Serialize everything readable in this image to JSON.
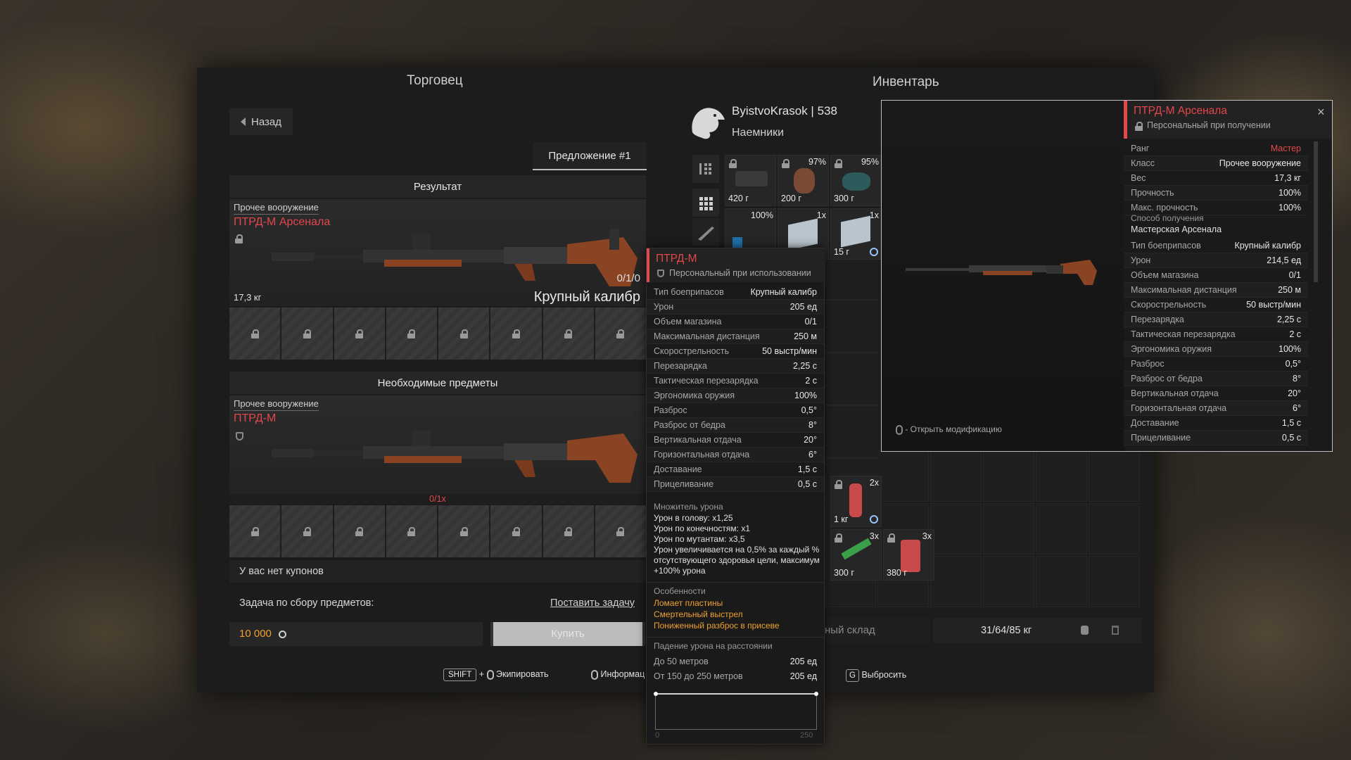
{
  "trader": {
    "title": "Торговец",
    "back": "Назад",
    "offer_tab": "Предложение #1",
    "result_title": "Результат",
    "result": {
      "category": "Прочее вооружение",
      "name": "ПТРД-М Арсенала",
      "weight": "17,3 кг",
      "ammo": "0/1/0",
      "caliber": "Крупный калибр"
    },
    "required_title": "Необходимые предметы",
    "required": {
      "category": "Прочее вооружение",
      "name": "ПТРД-М",
      "count": "0/1x"
    },
    "coupons": "У вас нет купонов",
    "task_label": "Задача по сбору предметов:",
    "task_link": "Поставить задачу",
    "price": "10 000",
    "buy": "Купить"
  },
  "inventory": {
    "title": "Инвентарь",
    "player": "ByistvoKrasok | 538",
    "faction": "Наемники",
    "storage": "ный склад",
    "weight": "31/64/85 кг",
    "items": [
      {
        "weight": "420 г",
        "count": ""
      },
      {
        "weight": "200 г",
        "count": "97%"
      },
      {
        "weight": "300 г",
        "count": "95%"
      },
      {
        "weight": "",
        "count": "100%"
      },
      {
        "weight": "",
        "count": "1x"
      },
      {
        "weight": "15 г",
        "count": "1x"
      },
      {
        "weight": "1 кг",
        "count": "2x"
      },
      {
        "weight": "300 г",
        "count": "3x"
      },
      {
        "weight": "380 г",
        "count": "3x"
      }
    ]
  },
  "bottom": {
    "shift": "SHIFT",
    "plus": "+",
    "equip": "Экипировать",
    "info": "Информац",
    "drop_key": "G",
    "drop": "Выбросить"
  },
  "tooltip": {
    "name": "ПТРД-М",
    "bind": "Персональный при использовании",
    "stats": [
      [
        "Тип боеприпасов",
        "Крупный калибр"
      ],
      [
        "Урон",
        "205 ед"
      ],
      [
        "Объем магазина",
        "0/1"
      ],
      [
        "Максимальная дистанция",
        "250 м"
      ],
      [
        "Скорострельность",
        "50 выстр/мин"
      ],
      [
        "Перезарядка",
        "2,25 с"
      ],
      [
        "Тактическая перезарядка",
        "2 с"
      ],
      [
        "Эргономика оружия",
        "100%"
      ],
      [
        "Разброс",
        "0,5°"
      ],
      [
        "Разброс от бедра",
        "8°"
      ],
      [
        "Вертикальная отдача",
        "20°"
      ],
      [
        "Горизонтальная отдача",
        "6°"
      ],
      [
        "Доставание",
        "1,5 с"
      ],
      [
        "Прицеливание",
        "0,5 с"
      ]
    ],
    "mult_title": "Множитель урона",
    "mult": [
      "Урон в голову: x1,25",
      "Урон по конечностям: x1",
      "Урон по мутантам: x3,5",
      "Урон увеличивается на 0,5% за каждый % отсутствующего здоровья цели, максимум +100% урона"
    ],
    "feat_title": "Особенности",
    "features": [
      "Ломает пластины",
      "Смертельный выстрел",
      "Пониженный разброс в присеве"
    ],
    "falloff_title": "Падение урона на расстоянии",
    "falloff": [
      [
        "До 50 метров",
        "205 ед"
      ],
      [
        "От 150 до 250 метров",
        "205 ед"
      ]
    ],
    "axis_min": "0",
    "axis_max": "250"
  },
  "detail": {
    "name": "ПТРД-М Арсенала",
    "bind": "Персональный при получении",
    "close": "×",
    "mod_hint": "- Открыть модификацию",
    "group1": [
      [
        "Ранг",
        "Мастер"
      ],
      [
        "Класс",
        "Прочее вооружение"
      ],
      [
        "Вес",
        "17,3 кг"
      ],
      [
        "Прочность",
        "100%"
      ],
      [
        "Макс. прочность",
        "100%"
      ]
    ],
    "origin_label": "Способ получения",
    "origin": "Мастерская Арсенала",
    "stats": [
      [
        "Тип боеприпасов",
        "Крупный калибр"
      ],
      [
        "Урон",
        "214,5 ед"
      ],
      [
        "Объем магазина",
        "0/1"
      ],
      [
        "Максимальная дистанция",
        "250 м"
      ],
      [
        "Скорострельность",
        "50 выстр/мин"
      ],
      [
        "Перезарядка",
        "2,25 с"
      ],
      [
        "Тактическая перезарядка",
        "2 с"
      ],
      [
        "Эргономика оружия",
        "100%"
      ],
      [
        "Разброс",
        "0,5°"
      ],
      [
        "Разброс от бедра",
        "8°"
      ],
      [
        "Вертикальная отдача",
        "20°"
      ],
      [
        "Горизонтальная отдача",
        "6°"
      ],
      [
        "Доставание",
        "1,5 с"
      ],
      [
        "Прицеливание",
        "0,5 с"
      ]
    ]
  },
  "colors": {
    "accent": "#e2474b",
    "orange": "#f0a030",
    "rank": "#e2474b"
  }
}
